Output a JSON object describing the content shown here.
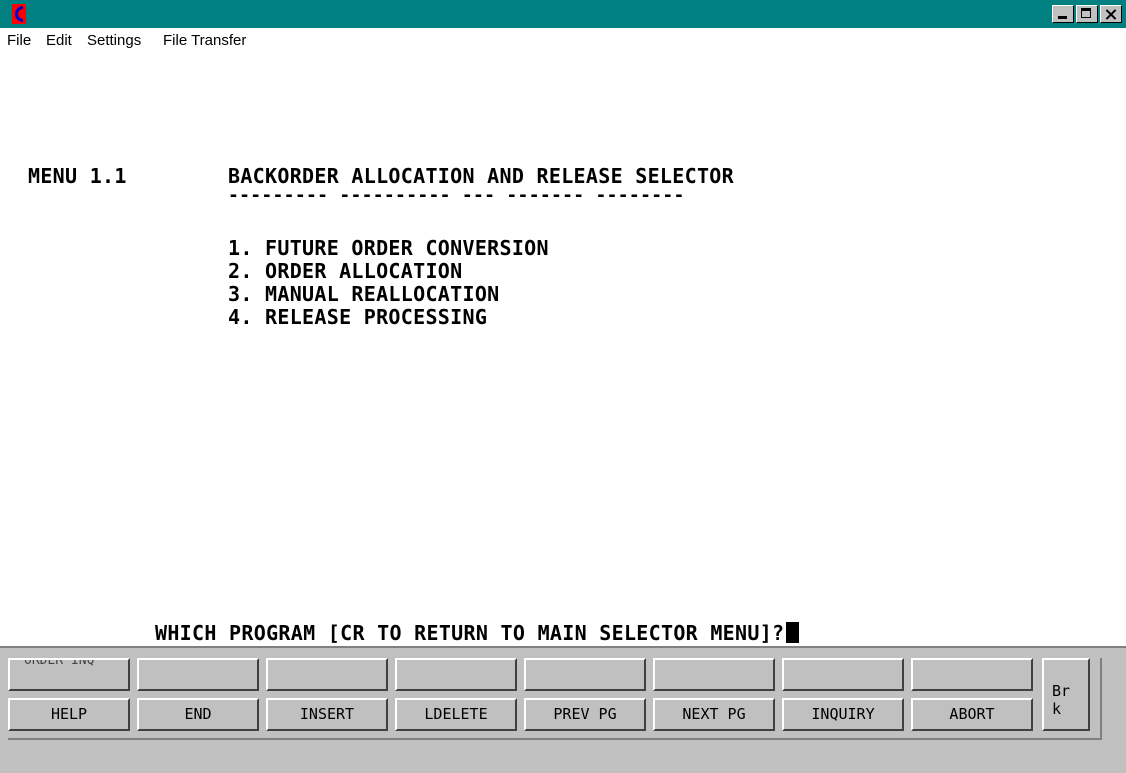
{
  "menubar": {
    "items": [
      {
        "label": "File"
      },
      {
        "label": "Edit"
      },
      {
        "label": "Settings"
      },
      {
        "label": "File Transfer"
      }
    ]
  },
  "screen": {
    "menu_id": "MENU 1.1",
    "title": "BACKORDER ALLOCATION AND RELEASE SELECTOR",
    "title_underline": "--------- ---------- --- ------- --------",
    "options": [
      "1. FUTURE ORDER CONVERSION",
      "2. ORDER ALLOCATION",
      "3. MANUAL REALLOCATION",
      "4. RELEASE PROCESSING"
    ],
    "prompt": "WHICH PROGRAM [CR TO RETURN TO MAIN SELECTOR MENU]?"
  },
  "function_keys": {
    "top_row": [
      "ORDER INQ",
      "",
      "",
      "",
      "",
      "",
      "",
      ""
    ],
    "bottom_row": [
      "HELP",
      "END",
      "INSERT",
      "LDELETE",
      "PREV PG",
      "NEXT PG",
      "INQUIRY",
      "ABORT"
    ],
    "break_key": "Br k"
  },
  "colors": {
    "titlebar": "#008080",
    "panel": "#c0c0c0"
  }
}
